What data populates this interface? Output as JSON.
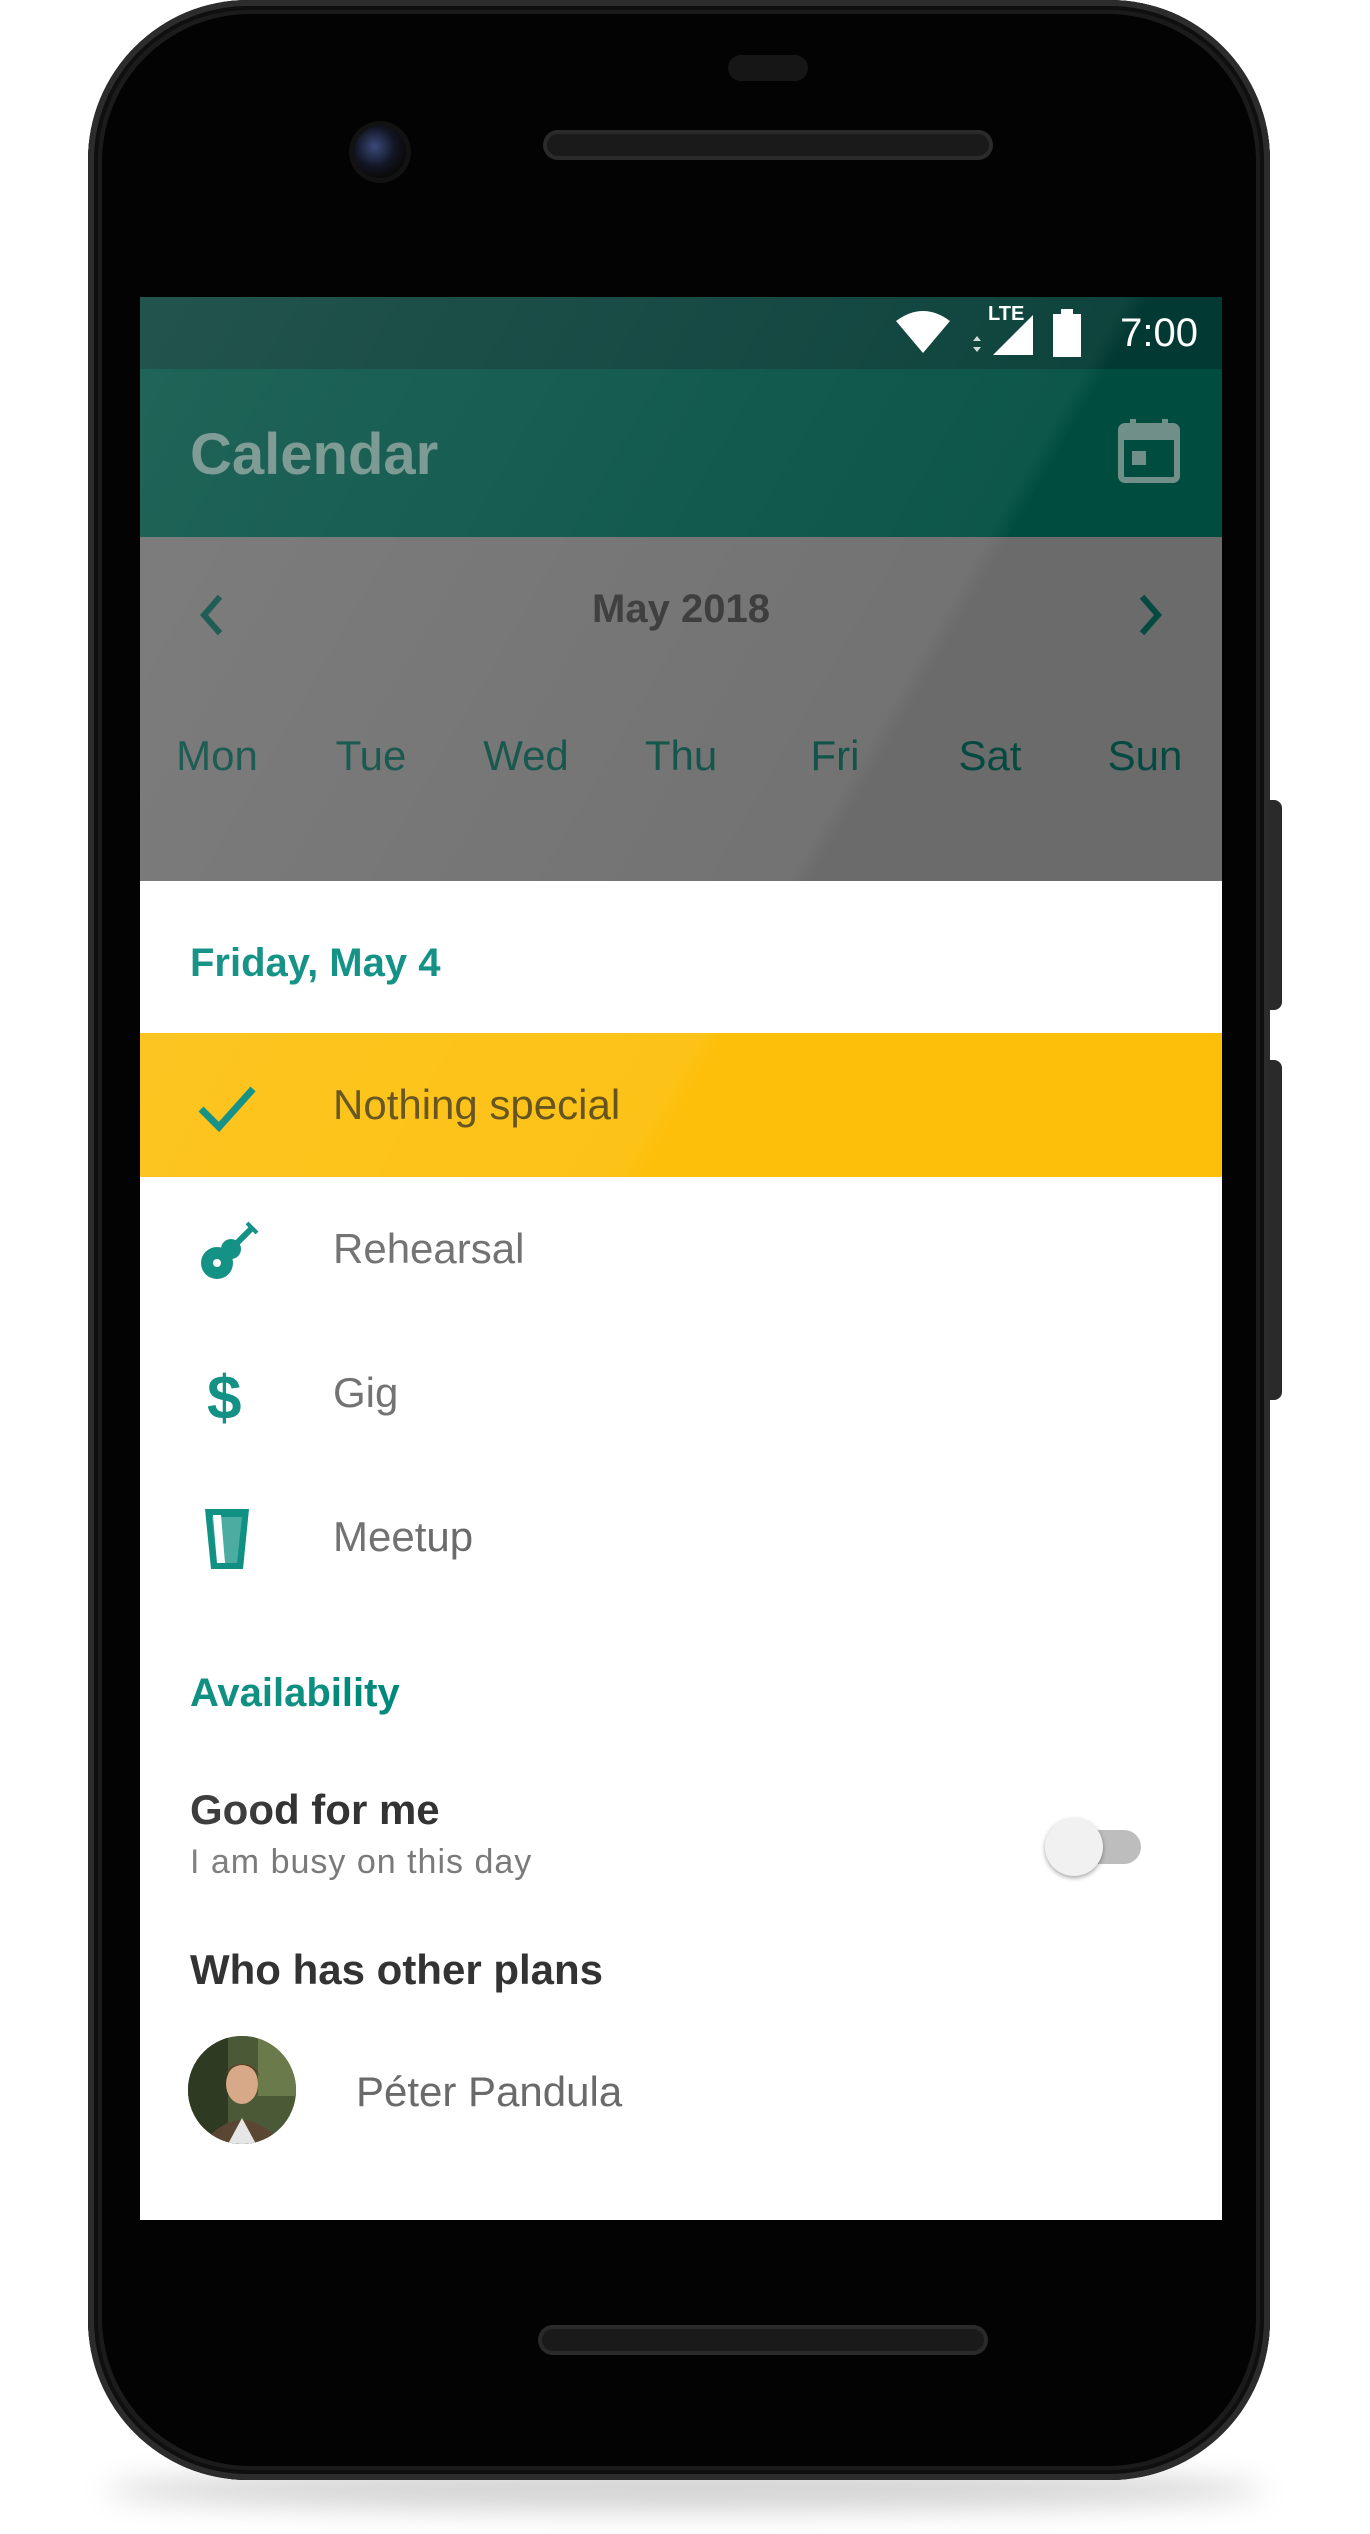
{
  "status_bar": {
    "network": "LTE",
    "time": "7:00"
  },
  "app_bar": {
    "title": "Calendar",
    "action_icon": "calendar-icon"
  },
  "month_nav": {
    "month": "May 2018",
    "prev_icon": "chevron-left-icon",
    "next_icon": "chevron-right-icon",
    "weekdays": [
      "Mon",
      "Tue",
      "Wed",
      "Thu",
      "Fri",
      "Sat",
      "Sun"
    ]
  },
  "day_header": "Friday, May 4",
  "options": [
    {
      "label": "Nothing special",
      "icon": "check-icon",
      "selected": true
    },
    {
      "label": "Rehearsal",
      "icon": "guitar-icon",
      "selected": false
    },
    {
      "label": "Gig",
      "icon": "dollar-icon",
      "selected": false
    },
    {
      "label": "Meetup",
      "icon": "glass-icon",
      "selected": false
    }
  ],
  "availability": {
    "heading": "Availability",
    "title": "Good for me",
    "subtitle": "I am busy on this day",
    "toggle_on": false
  },
  "others": {
    "heading": "Who has other plans",
    "people": [
      {
        "name": "Péter Pandula"
      }
    ]
  },
  "colors": {
    "primary_dark": "#023a33",
    "primary": "#004d40",
    "accent_teal": "#00897b",
    "selected_bg": "#fdbf0a"
  }
}
